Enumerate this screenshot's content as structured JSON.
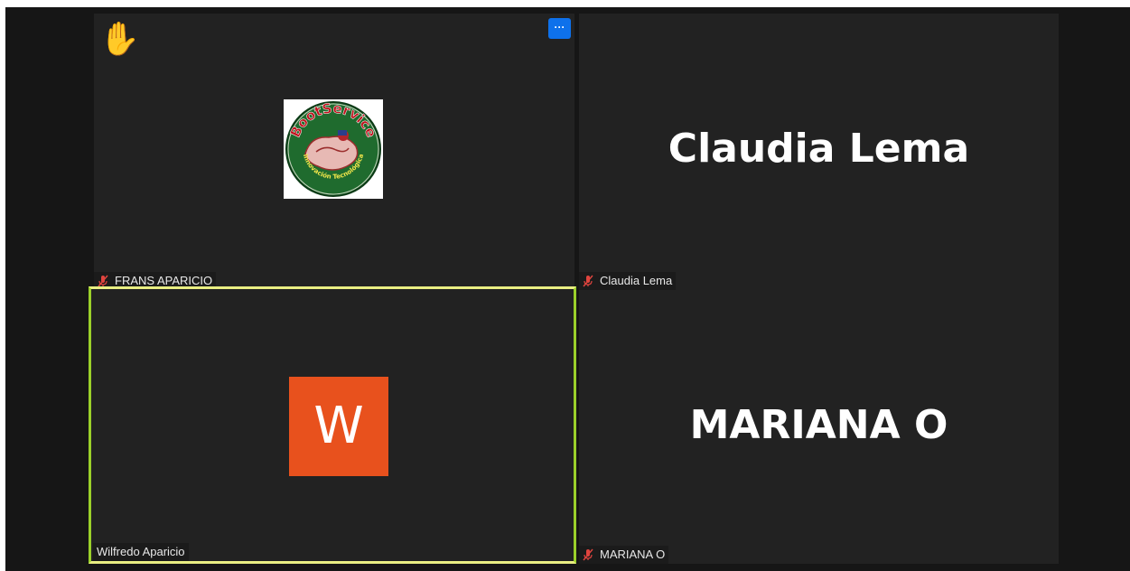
{
  "participants": [
    {
      "name": "FRANS APARICIO",
      "muted": true,
      "hand_raised": true,
      "video": "logo",
      "logo_text": "BootService",
      "logo_subtext": "Innovación Tecnológica"
    },
    {
      "name": "Claudia Lema",
      "muted": true,
      "display_name": "Claudia Lema"
    },
    {
      "name": "Wilfredo Aparicio",
      "muted": false,
      "active_speaker": true,
      "avatar_letter": "W",
      "avatar_color": "#e8511d"
    },
    {
      "name": "MARIANA O",
      "muted": true,
      "display_name": "MARIANA O"
    }
  ],
  "more_button_label": "···",
  "hand_icon": "✋",
  "colors": {
    "background": "#161616",
    "tile": "#222222",
    "active_border": "#e9ee82",
    "more_button": "#0e71eb",
    "mute_icon": "#e0443e"
  }
}
